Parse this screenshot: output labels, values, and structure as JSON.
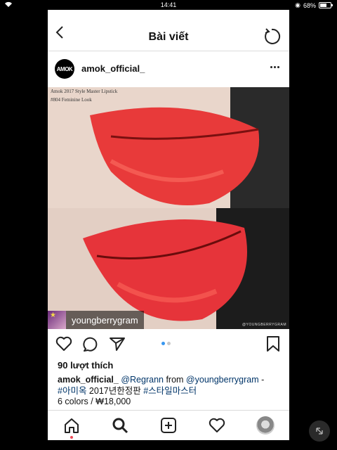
{
  "status_bar": {
    "time": "14:41",
    "battery": "68%",
    "battery_level": 0.68
  },
  "nav": {
    "title": "Bài viết"
  },
  "post": {
    "username": "amok_official_",
    "avatar_text": "AMOK",
    "photo_caption_line1": "Amok 2017 Style Master Lipstick",
    "photo_caption_line2": "#804 Feminine Look",
    "watermark": "@YOUNGBERRYGRAM",
    "regram_user": "youngberrygram",
    "carousel": {
      "count": 2,
      "active": 0
    },
    "likes": "90 lượt thích",
    "caption": {
      "user": "amok_official_",
      "mention1": "@Regrann",
      "from": " from ",
      "mention2": "@youngberrygram",
      "dash": " -",
      "tag1": "#아미옥",
      "middle": " 2017년한정판 ",
      "tag2": "#스타일마스터"
    },
    "price_line": "6 colors / ₩18,000"
  },
  "colors": {
    "link": "#003569",
    "accent": "#3897f0",
    "notification": "#ed4956",
    "lipstick": "#e83a3a"
  },
  "icons": [
    "wifi-icon",
    "back-icon",
    "refresh-icon",
    "more-icon",
    "heart-icon",
    "comment-icon",
    "share-icon",
    "bookmark-icon",
    "home-icon",
    "search-icon",
    "add-icon",
    "activity-icon",
    "profile-icon",
    "minimize-icon"
  ]
}
